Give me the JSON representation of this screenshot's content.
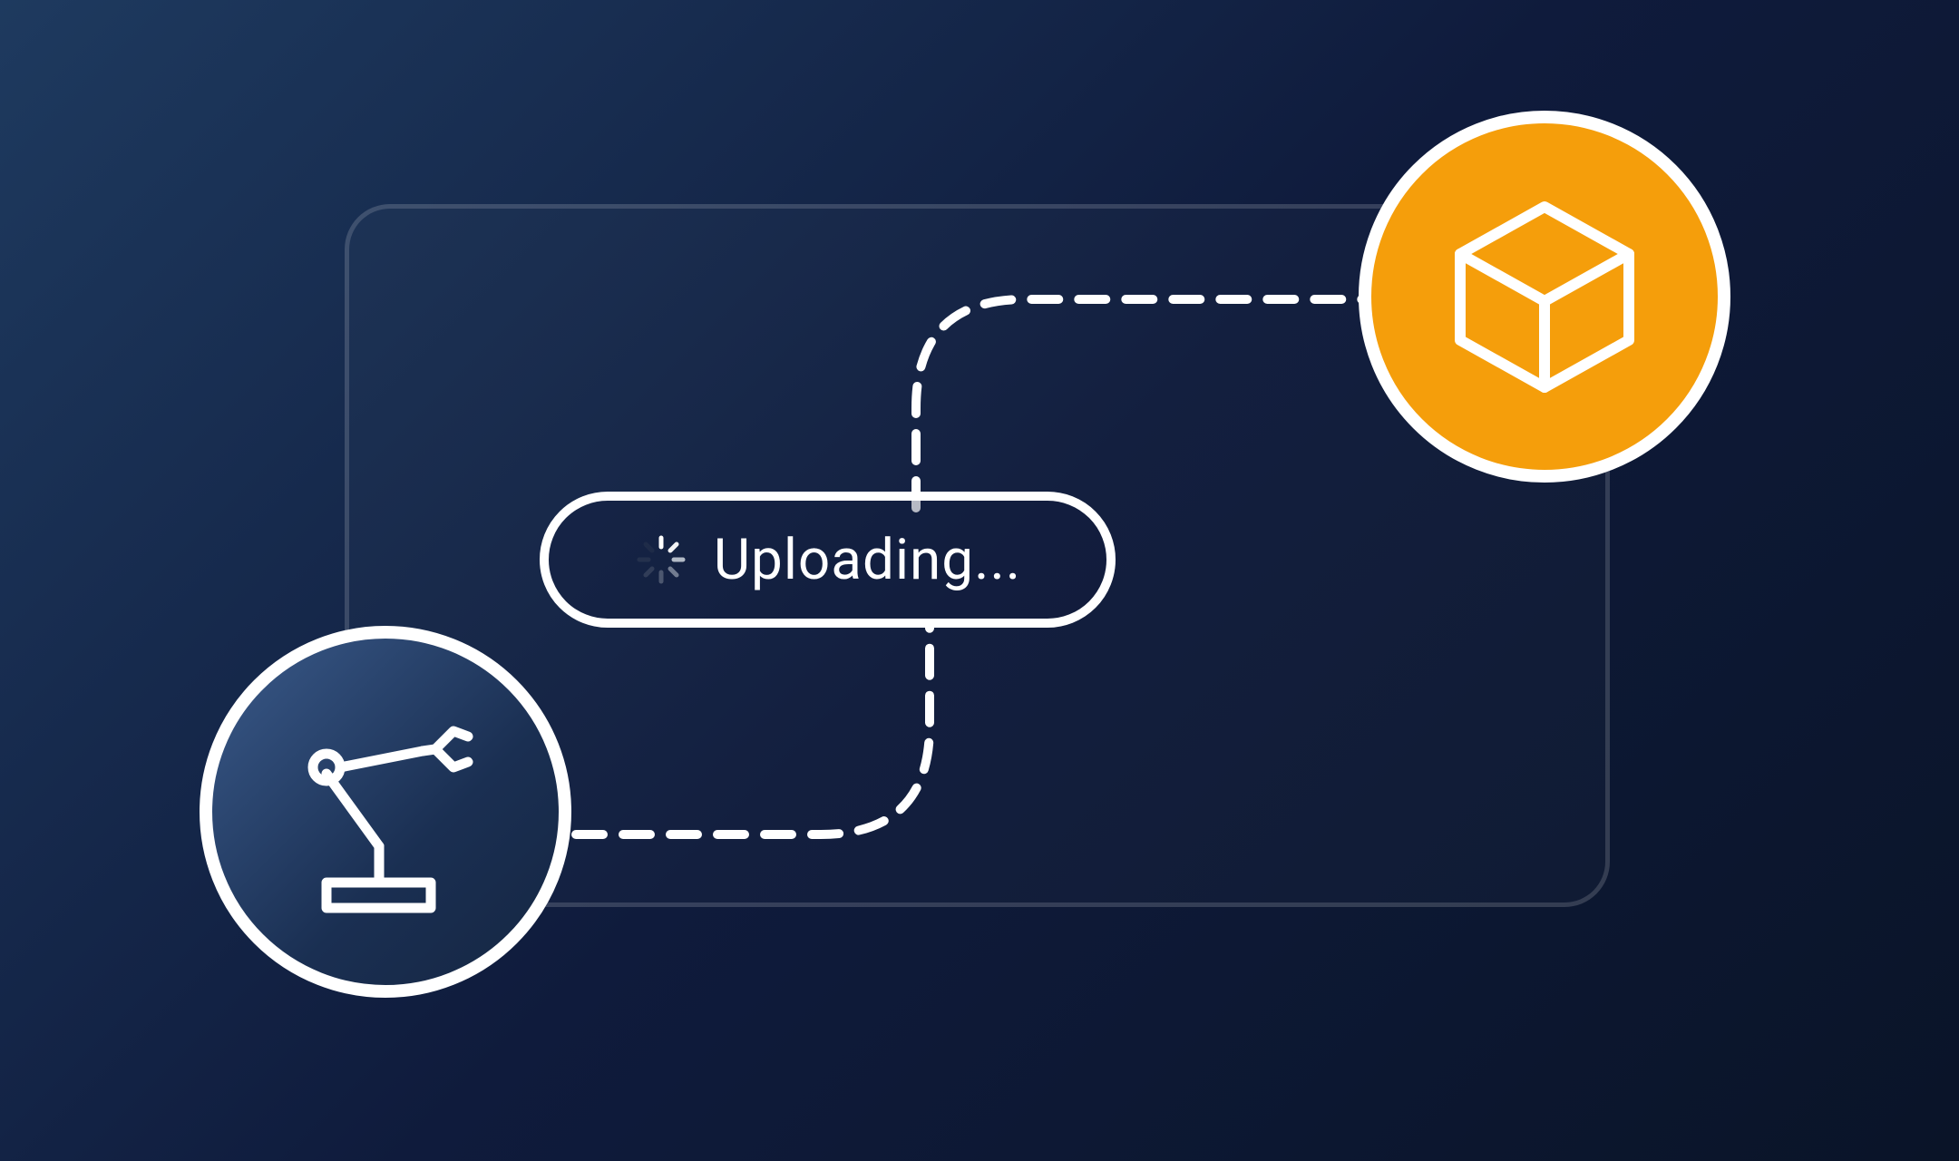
{
  "diagram": {
    "status_label": "Uploading...",
    "source_icon": "robot-arm",
    "destination_icon": "package-box",
    "colors": {
      "background_gradient_start": "#1e3a5f",
      "background_gradient_end": "#0a1428",
      "accent_orange": "#f59e0b",
      "line_white": "#ffffff",
      "panel_border": "rgba(255,255,255,0.15)"
    }
  }
}
